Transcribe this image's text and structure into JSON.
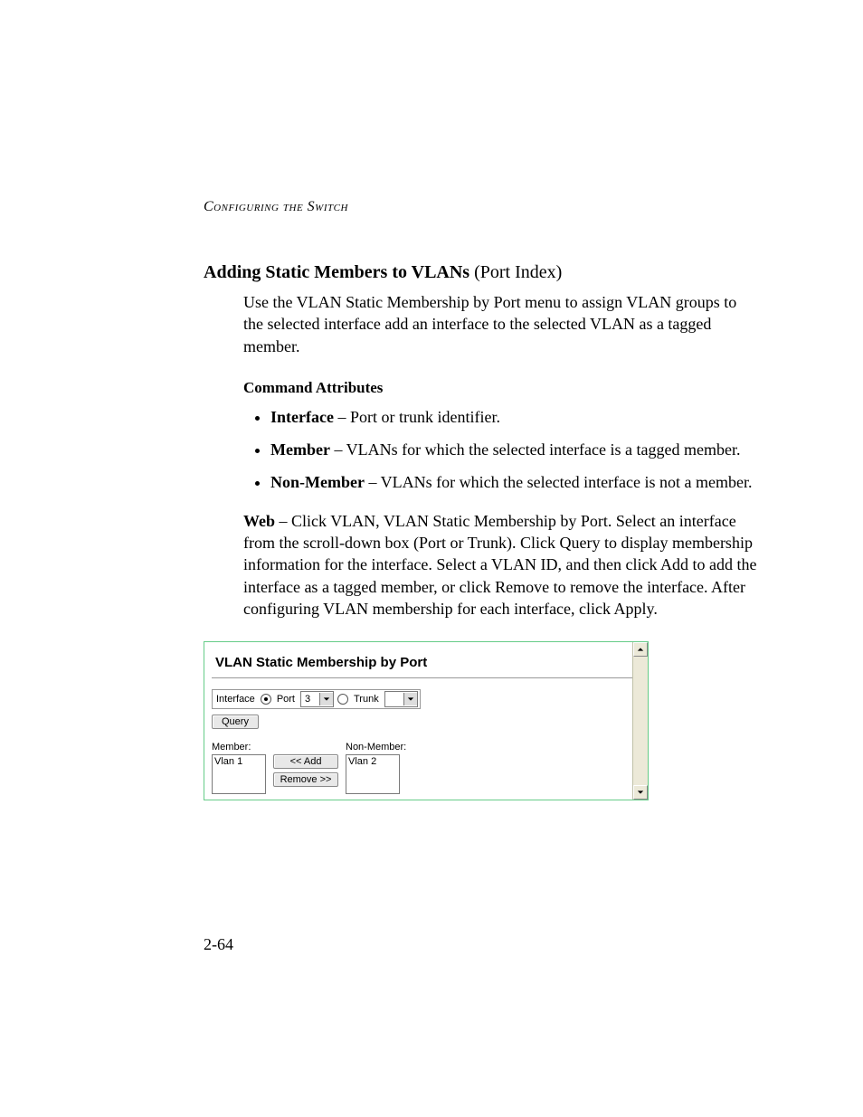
{
  "runningHead": "Configuring the Switch",
  "heading": {
    "main": "Adding Static Members to VLANs",
    "suffix": " (Port Index)"
  },
  "intro": "Use the VLAN Static Membership by Port menu to assign VLAN groups to the selected interface add an interface to the selected VLAN as a tagged member.",
  "attrHeading": "Command Attributes",
  "bullets": [
    {
      "term": "Interface",
      "desc": " – Port or trunk identifier."
    },
    {
      "term": "Member",
      "desc": " – VLANs for which the selected interface is a tagged member."
    },
    {
      "term": "Non-Member",
      "desc": " – VLANs for which the selected interface is not a member."
    }
  ],
  "webPara": {
    "lead": "Web",
    "body": " – Click VLAN, VLAN Static Membership by Port. Select an interface from the scroll-down box (Port or Trunk). Click Query to display membership information for the interface. Select a VLAN ID, and then click Add to add the interface as a tagged member, or click Remove to remove the interface. After configuring VLAN membership for each interface, click Apply."
  },
  "shot": {
    "title": "VLAN Static Membership by Port",
    "ifaceLabel": "Interface",
    "portLabel": "Port",
    "portValue": "3",
    "trunkLabel": "Trunk",
    "trunkValue": "",
    "queryLabel": "Query",
    "memberLabel": "Member:",
    "nonMemberLabel": "Non-Member:",
    "memberItems": [
      "Vlan 1"
    ],
    "nonMemberItems": [
      "Vlan 2"
    ],
    "addLabel": "<< Add",
    "removeLabel": "Remove >>"
  },
  "pageNumber": "2-64"
}
